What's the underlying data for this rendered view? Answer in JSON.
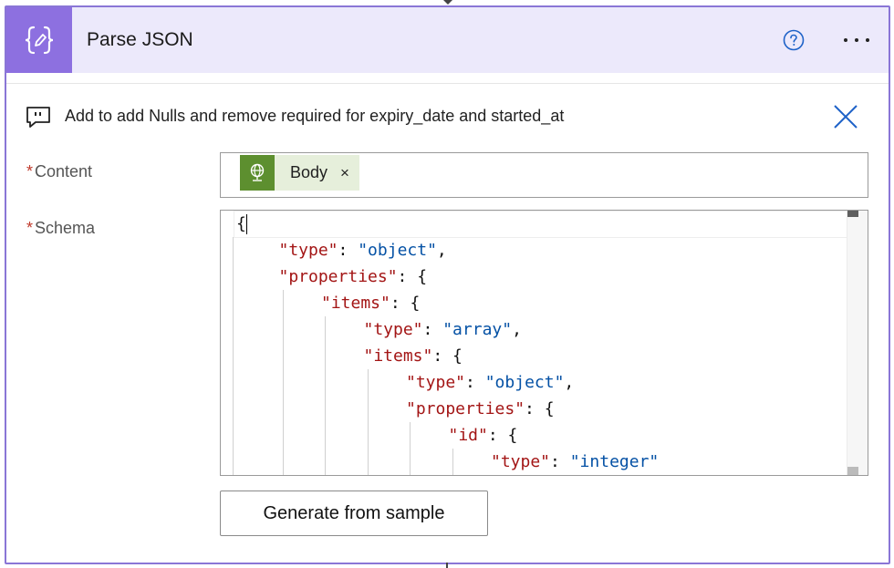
{
  "header": {
    "title": "Parse JSON",
    "icon": "curly-braces-pencil-icon",
    "help_icon": "help-circle-icon",
    "more_icon": "ellipsis-icon"
  },
  "comment": {
    "icon": "comment-icon",
    "text": "Add to add Nulls and remove required for expiry_date and started_at",
    "close_icon": "close-icon"
  },
  "fields": {
    "content": {
      "required_mark": "*",
      "label": "Content",
      "token": {
        "label": "Body",
        "remove": "×",
        "icon": "globe-icon"
      }
    },
    "schema": {
      "required_mark": "*",
      "label": "Schema",
      "lines": [
        {
          "indent": 0,
          "parts": [
            {
              "t": "p",
              "v": "{"
            }
          ]
        },
        {
          "indent": 1,
          "parts": [
            {
              "t": "k",
              "v": "\"type\""
            },
            {
              "t": "p",
              "v": ": "
            },
            {
              "t": "s",
              "v": "\"object\""
            },
            {
              "t": "p",
              "v": ","
            }
          ]
        },
        {
          "indent": 1,
          "parts": [
            {
              "t": "k",
              "v": "\"properties\""
            },
            {
              "t": "p",
              "v": ": {"
            }
          ]
        },
        {
          "indent": 2,
          "parts": [
            {
              "t": "k",
              "v": "\"items\""
            },
            {
              "t": "p",
              "v": ": {"
            }
          ]
        },
        {
          "indent": 3,
          "parts": [
            {
              "t": "k",
              "v": "\"type\""
            },
            {
              "t": "p",
              "v": ": "
            },
            {
              "t": "s",
              "v": "\"array\""
            },
            {
              "t": "p",
              "v": ","
            }
          ]
        },
        {
          "indent": 3,
          "parts": [
            {
              "t": "k",
              "v": "\"items\""
            },
            {
              "t": "p",
              "v": ": {"
            }
          ]
        },
        {
          "indent": 4,
          "parts": [
            {
              "t": "k",
              "v": "\"type\""
            },
            {
              "t": "p",
              "v": ": "
            },
            {
              "t": "s",
              "v": "\"object\""
            },
            {
              "t": "p",
              "v": ","
            }
          ]
        },
        {
          "indent": 4,
          "parts": [
            {
              "t": "k",
              "v": "\"properties\""
            },
            {
              "t": "p",
              "v": ": {"
            }
          ]
        },
        {
          "indent": 5,
          "parts": [
            {
              "t": "k",
              "v": "\"id\""
            },
            {
              "t": "p",
              "v": ": {"
            }
          ]
        },
        {
          "indent": 6,
          "parts": [
            {
              "t": "k",
              "v": "\"type\""
            },
            {
              "t": "p",
              "v": ": "
            },
            {
              "t": "s",
              "v": "\"integer\""
            }
          ]
        }
      ]
    }
  },
  "actions": {
    "generate_label": "Generate from sample"
  },
  "colors": {
    "accent": "#8d70e0",
    "header_bg": "#ece9fb",
    "token_icon_bg": "#5d8f2f",
    "token_bg": "#e6efdb",
    "close_blue": "#1e62c8",
    "json_key": "#a31515",
    "json_string": "#0451a5"
  }
}
